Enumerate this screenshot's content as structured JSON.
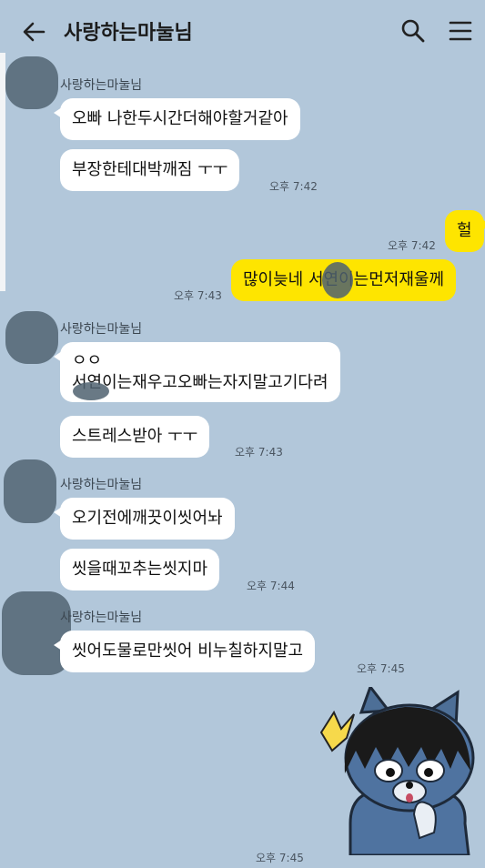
{
  "header": {
    "title": "사랑하는마눌님",
    "back_icon": "arrow-left-icon",
    "search_icon": "search-icon",
    "menu_icon": "menu-icon"
  },
  "colors": {
    "background": "#b2c7da",
    "incoming_bubble": "#ffffff",
    "outgoing_bubble": "#fee500"
  },
  "messages": [
    {
      "sender": "사랑하는마눌님",
      "text": "오빠 나한두시간더해야할거같아"
    },
    {
      "text": "부장한테대박깨짐 ㅜㅜ",
      "time": "오후 7:42"
    },
    {
      "me": true,
      "text": "헐",
      "time": "오후 7:42"
    },
    {
      "me": true,
      "text": "많이늦네 서연이는먼저재울께",
      "time": "오후 7:43"
    },
    {
      "sender": "사랑하는마눌님",
      "text_line1": "ㅇㅇ",
      "text_line2": "서연이는재우고오빠는자지말고기다려"
    },
    {
      "text": "스트레스받아 ㅜㅜ",
      "time": "오후 7:43"
    },
    {
      "sender": "사랑하는마눌님",
      "text": "오기전에깨끗이씻어놔"
    },
    {
      "text": "씻을때꼬추는씻지마",
      "time": "오후 7:44"
    },
    {
      "sender": "사랑하는마눌님",
      "text": "씻어도물로만씻어 비누칠하지말고",
      "time": "오후 7:45"
    },
    {
      "me": true,
      "sticker": "neo-cat-sticker",
      "time": "오후 7:45"
    }
  ]
}
